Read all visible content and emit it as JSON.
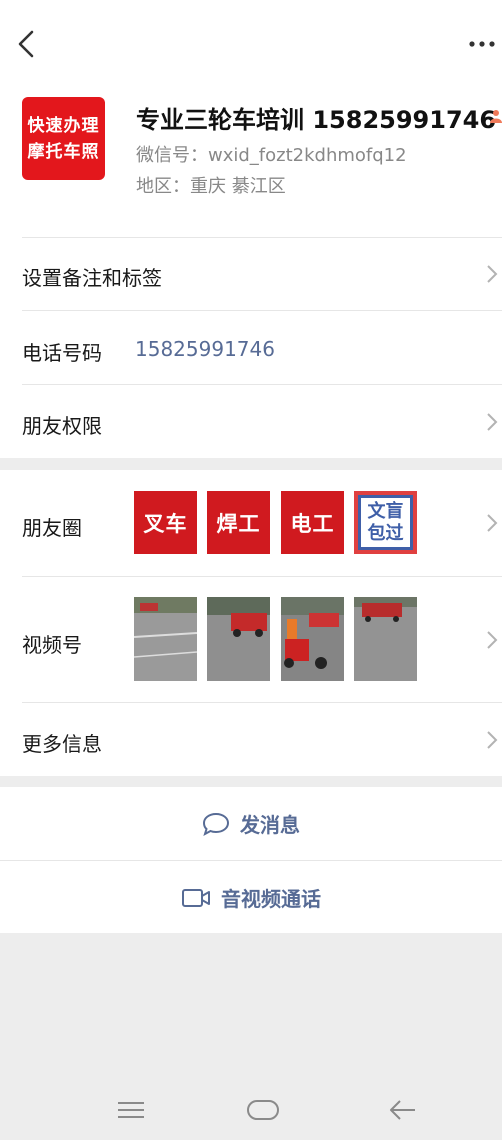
{
  "profile": {
    "avatar_lines": [
      "快速办理",
      "摩托车照"
    ],
    "name": "专业三轮车培训 15825991746",
    "wxid": "微信号：wxid_fozt2kdhmofq12",
    "region": "地区：重庆  綦江区"
  },
  "rows": {
    "remark_label": "设置备注和标签",
    "phone_label": "电话号码",
    "phone_value": "15825991746",
    "permission_label": "朋友权限",
    "moments_label": "朋友圈",
    "channels_label": "视频号",
    "more_info_label": "更多信息"
  },
  "moments_thumbs": [
    "叉车",
    "焊工",
    "电工",
    "文盲包过"
  ],
  "actions": {
    "message_label": "发消息",
    "call_label": "音视频通话"
  },
  "colors": {
    "link": "#576b95",
    "avatar_red": "#e3171c",
    "thumb_red": "#d01a1f"
  }
}
